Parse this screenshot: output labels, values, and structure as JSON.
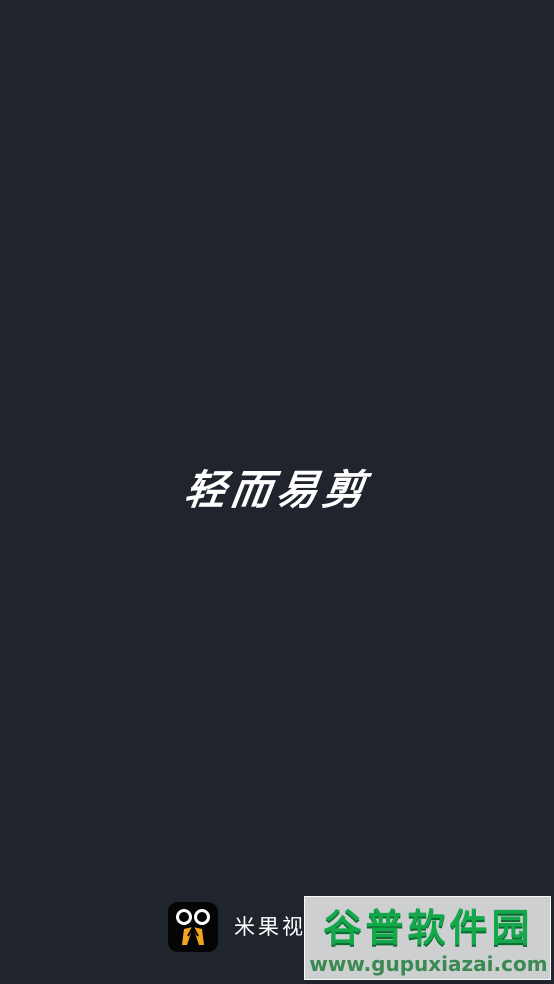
{
  "splash": {
    "slogan": "轻而易剪"
  },
  "brand": {
    "app_name": "米果视",
    "icon": "scissors-face-icon",
    "icon_colors": {
      "background": "#050505",
      "eyes": "#ffffff",
      "blades": "#f4a51f"
    }
  },
  "watermark": {
    "title": "谷普软件园",
    "url": "www.gupuxiazai.com"
  },
  "colors": {
    "background": "#20242d",
    "text": "#ffffff",
    "watermark_green": "#13a94b"
  }
}
